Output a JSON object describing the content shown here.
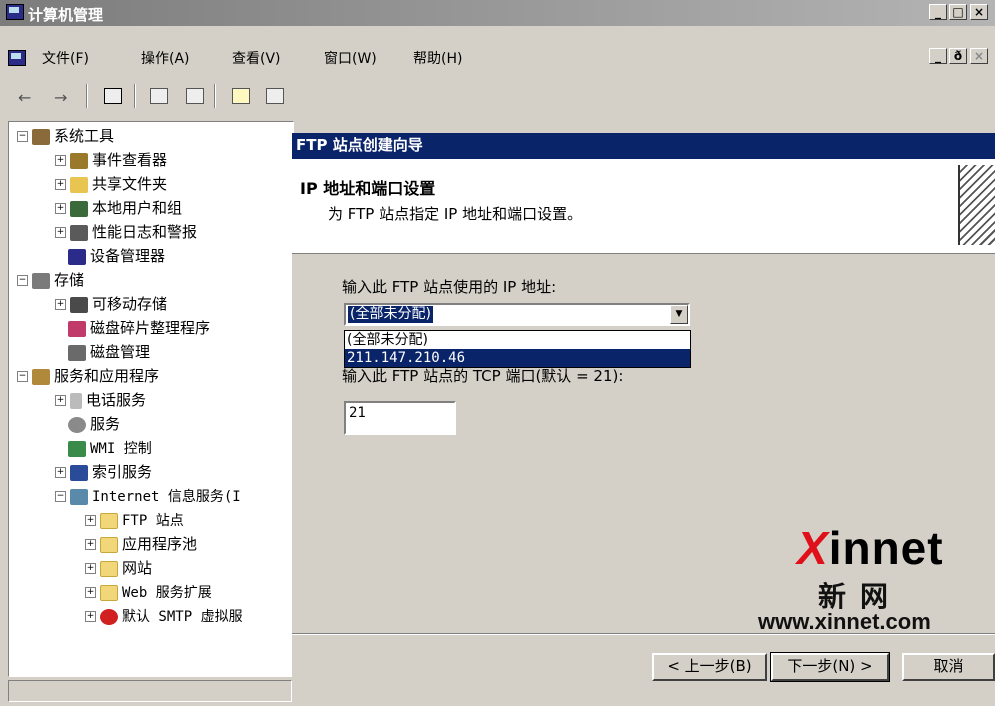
{
  "window": {
    "title": "计算机管理",
    "caption_buttons": [
      "_",
      "□",
      "×"
    ],
    "mdi_buttons": [
      "_",
      "ð",
      "×"
    ]
  },
  "menu": {
    "items": [
      "文件(F)",
      "操作(A)",
      "查看(V)",
      "窗口(W)",
      "帮助(H)"
    ]
  },
  "toolbar": {
    "icons": [
      "back-arrow-icon",
      "forward-arrow-icon",
      "show-hide-tree-icon",
      "properties-icon",
      "export-list-icon",
      "help-icon",
      "console-icon"
    ],
    "back_glyph": "←",
    "forward_glyph": "→"
  },
  "tree": {
    "items": [
      {
        "label": "系统工具",
        "expander": "−",
        "icon": "system-tools-icon"
      },
      {
        "label": "事件查看器",
        "expander": "+",
        "icon": "event-viewer-icon"
      },
      {
        "label": "共享文件夹",
        "expander": "+",
        "icon": "shared-folders-icon"
      },
      {
        "label": "本地用户和组",
        "expander": "+",
        "icon": "users-groups-icon"
      },
      {
        "label": "性能日志和警报",
        "expander": "+",
        "icon": "performance-logs-icon"
      },
      {
        "label": "设备管理器",
        "expander": "",
        "icon": "device-manager-icon"
      },
      {
        "label": "存储",
        "expander": "−",
        "icon": "storage-icon"
      },
      {
        "label": "可移动存储",
        "expander": "+",
        "icon": "removable-storage-icon"
      },
      {
        "label": "磁盘碎片整理程序",
        "expander": "",
        "icon": "defragmenter-icon"
      },
      {
        "label": "磁盘管理",
        "expander": "",
        "icon": "disk-management-icon"
      },
      {
        "label": "服务和应用程序",
        "expander": "−",
        "icon": "services-apps-icon"
      },
      {
        "label": "电话服务",
        "expander": "+",
        "icon": "telephony-icon"
      },
      {
        "label": "服务",
        "expander": "",
        "icon": "services-icon"
      },
      {
        "label": "WMI 控制",
        "expander": "",
        "icon": "wmi-control-icon"
      },
      {
        "label": "索引服务",
        "expander": "+",
        "icon": "indexing-service-icon"
      },
      {
        "label": "Internet 信息服务(I",
        "expander": "−",
        "icon": "iis-icon"
      },
      {
        "label": "FTP 站点",
        "expander": "+",
        "icon": "folder-icon"
      },
      {
        "label": "应用程序池",
        "expander": "+",
        "icon": "folder-icon"
      },
      {
        "label": "网站",
        "expander": "+",
        "icon": "folder-icon"
      },
      {
        "label": "Web 服务扩展",
        "expander": "+",
        "icon": "folder-icon"
      },
      {
        "label": "默认 SMTP 虚拟服",
        "expander": "+",
        "icon": "smtp-server-icon"
      }
    ]
  },
  "wizard": {
    "title": "FTP 站点创建向导",
    "header_title": "IP 地址和端口设置",
    "header_subtitle": "为 FTP 站点指定 IP 地址和端口设置。",
    "ip_label": "输入此 FTP 站点使用的 IP 地址:",
    "ip_selected": "(全部未分配)",
    "ip_options": [
      "(全部未分配)",
      "211.147.210.46"
    ],
    "port_label": "输入此 FTP 站点的 TCP 端口(默认 = 21):",
    "port_value": "21",
    "buttons": {
      "back": "< 上一步(B)",
      "next": "下一步(N) >",
      "cancel": "取消"
    }
  },
  "watermark": {
    "logo_x": "X",
    "logo_rest": "innet",
    "cn": "新网",
    "url": "www.xinnet.com",
    "accent": "#e0101a"
  },
  "colors": {
    "selection": "#0a246a",
    "chrome": "#d4d0c8"
  }
}
